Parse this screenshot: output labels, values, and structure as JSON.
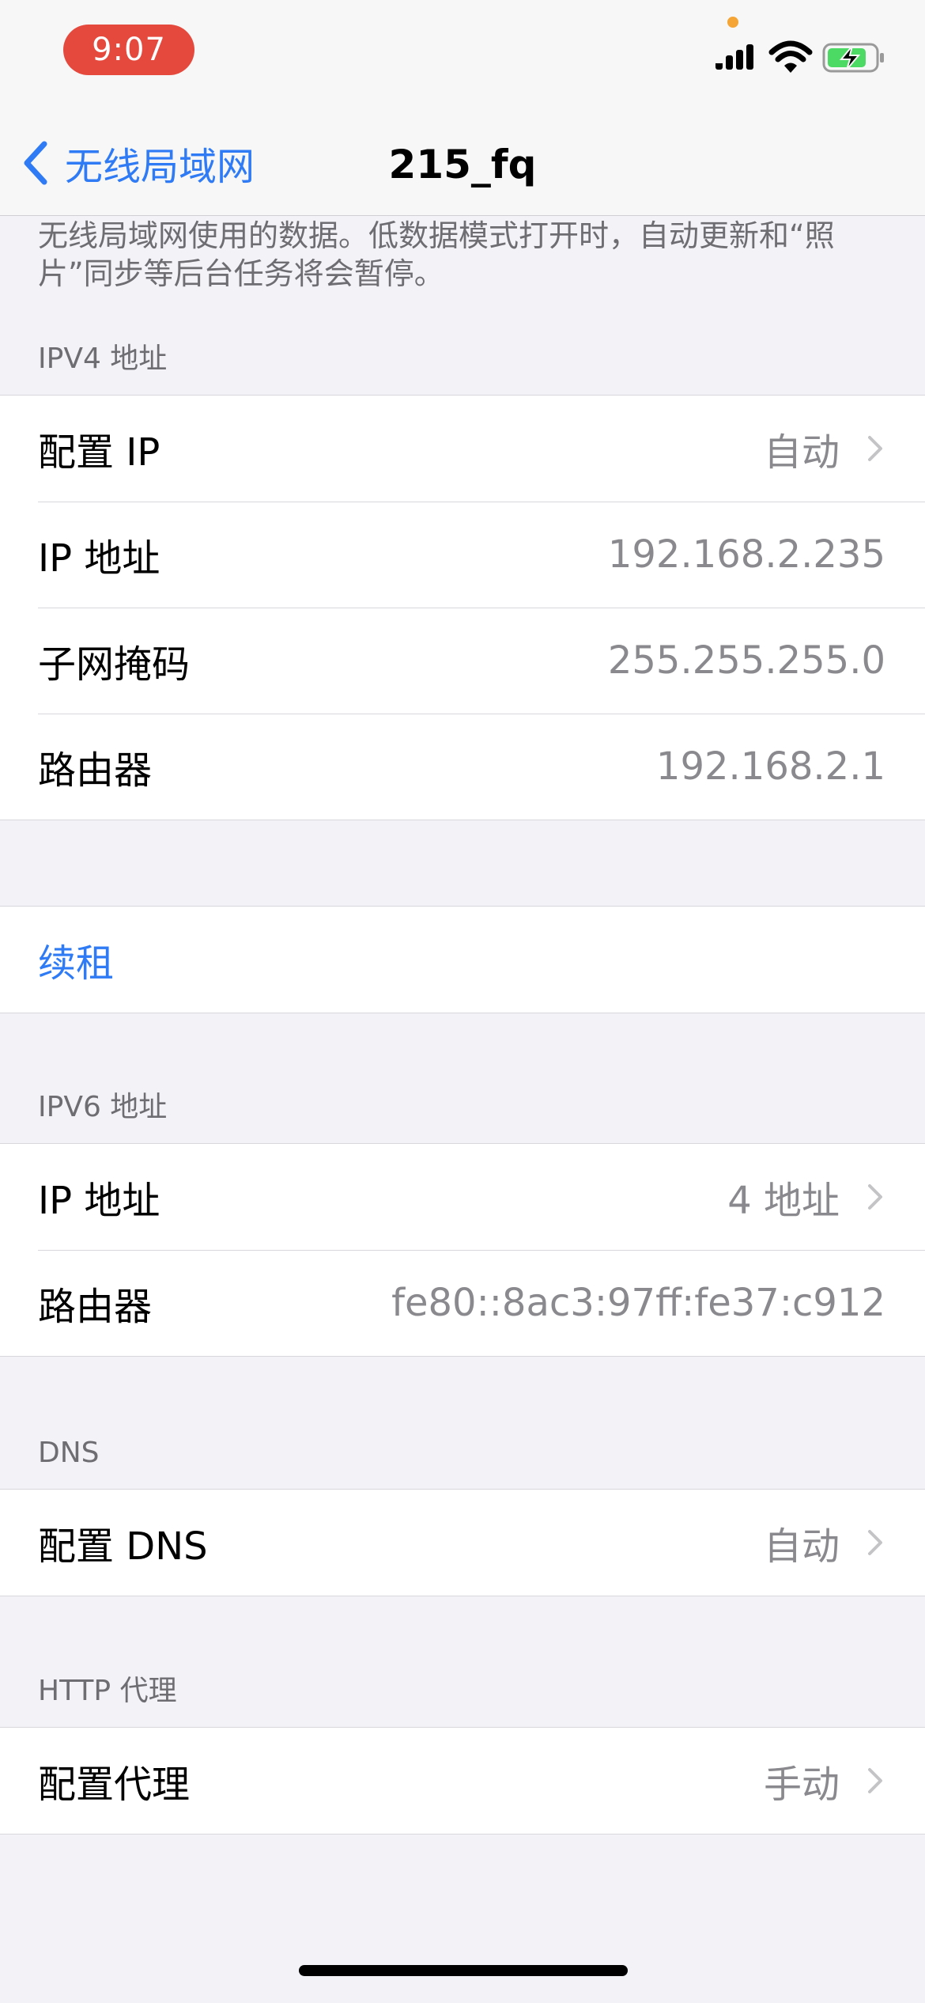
{
  "status_bar": {
    "time": "9:07",
    "icons": [
      "signal-icon",
      "wifi-icon",
      "battery-charging-icon"
    ],
    "pill_color": "#e5493d",
    "battery_color": "#4cd964"
  },
  "nav": {
    "back_label": "无线局域网",
    "title": "215_fq"
  },
  "description": "无线局域网使用的数据。低数据模式打开时，自动更新和“照片”同步等后台任务将会暂停。",
  "ipv4": {
    "header": "IPV4 地址",
    "rows": [
      {
        "label": "配置 IP",
        "value": "自动"
      },
      {
        "label": "IP 地址",
        "value": "192.168.2.235"
      },
      {
        "label": "子网掩码",
        "value": "255.255.255.0"
      },
      {
        "label": "路由器",
        "value": "192.168.2.1"
      }
    ]
  },
  "renew": {
    "label": "续租"
  },
  "ipv6": {
    "header": "IPV6 地址",
    "rows": [
      {
        "label": "IP 地址",
        "value": "4 地址"
      },
      {
        "label": "路由器",
        "value": "fe80::8ac3:97ff:fe37:c912"
      }
    ]
  },
  "dns": {
    "header": "DNS",
    "rows": [
      {
        "label": "配置 DNS",
        "value": "自动"
      }
    ]
  },
  "http_proxy": {
    "header": "HTTP 代理",
    "rows": [
      {
        "label": "配置代理",
        "value": "手动"
      }
    ]
  },
  "accent_color": "#2f7bf5"
}
